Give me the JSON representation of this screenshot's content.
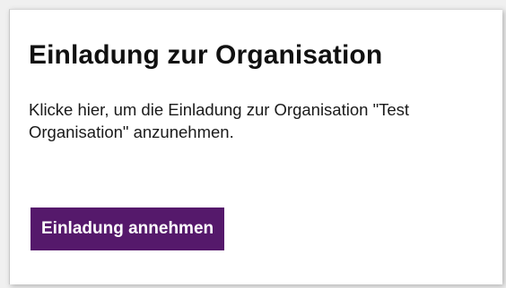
{
  "card": {
    "title": "Einladung zur Organisation",
    "message": "Klicke hier, um die Einladung zur Organisation \"Test Organisation\" anzunehmen.",
    "accept_label": "Einladung annehmen"
  },
  "colors": {
    "button_background": "#55196b",
    "button_text": "#ffffff",
    "title_text": "#111111"
  }
}
